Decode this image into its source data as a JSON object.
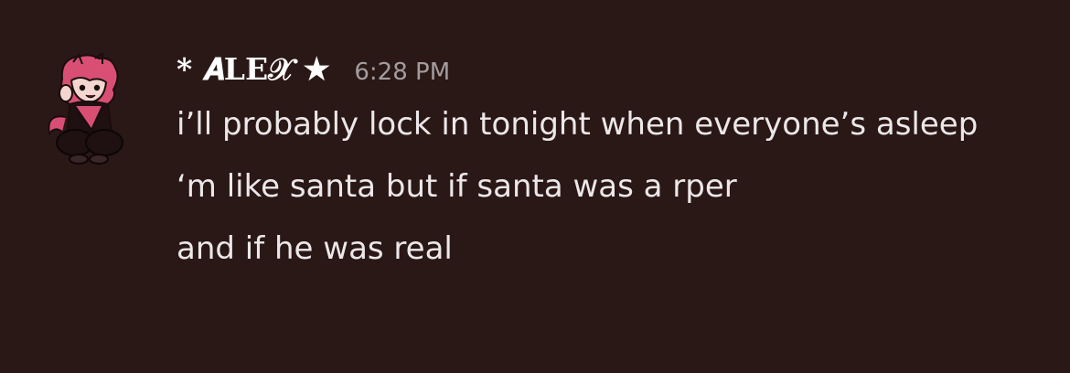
{
  "message": {
    "author": "* 𝑨LE𝒳 ★",
    "timestamp": "6:28 PM",
    "lines": [
      "i’ll probably lock in tonight when everyone’s asleep",
      "‘m like santa but if santa was a rper",
      "and if he was real"
    ]
  },
  "colors": {
    "background": "#2a1816",
    "username": "#ffffff",
    "timestamp": "#a39c9f",
    "text": "#ece7e9",
    "avatar_accent": "#d94f74"
  },
  "icons": {
    "avatar": "character-avatar"
  }
}
